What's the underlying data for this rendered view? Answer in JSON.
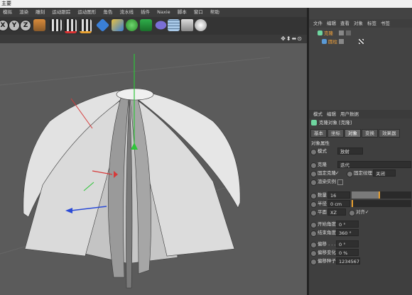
{
  "window": {
    "title": "主要"
  },
  "menu": [
    "模拟",
    "渲染",
    "雕刻",
    "运动跟踪",
    "运动图形",
    "角色",
    "流水线",
    "插件",
    "Naxie",
    "脚本",
    "窗口",
    "帮助"
  ],
  "toolbar": {
    "axis_x": "X",
    "axis_y": "Y",
    "axis_z": "Z"
  },
  "object_manager": {
    "menu": [
      "文件",
      "编辑",
      "查看",
      "对象",
      "标签",
      "书签"
    ],
    "objects": [
      {
        "name": "克隆",
        "color": "#f0a23c"
      },
      {
        "name": "圆柱",
        "color": "#f0a23c"
      }
    ]
  },
  "attribute_manager": {
    "menu": [
      "模式",
      "编辑",
      "用户数据"
    ],
    "header": "克隆对象 [克隆]",
    "tabs": [
      "基本",
      "坐标",
      "对象",
      "变换",
      "效果器"
    ],
    "active_tab": "对象",
    "section": "对象属性",
    "mode": {
      "label": "模式",
      "value": "放射"
    },
    "clone": {
      "label": "克隆",
      "value": "迭代"
    },
    "fixed_clone": {
      "label": "固定克隆",
      "check": "✓"
    },
    "fixed_texture": {
      "label": "固定纹理",
      "value": "关闭"
    },
    "render_instance": {
      "label": "渲染实例"
    },
    "count": {
      "label": "数量",
      "value": "16",
      "fill": 0.45
    },
    "radius": {
      "label": "半径",
      "value": "0 cm"
    },
    "plane": {
      "label": "平面",
      "value": "XZ"
    },
    "align": {
      "label": "对齐",
      "check": "✓"
    },
    "start_angle": {
      "label": "开始角度",
      "value": "0 °"
    },
    "end_angle": {
      "label": "结束角度",
      "value": "360 °"
    },
    "offset": {
      "label": "偏移 . . .",
      "value": "0 °"
    },
    "offset_variation": {
      "label": "偏移变化",
      "value": "0 %"
    },
    "offset_seed": {
      "label": "偏移种子",
      "value": "1234567"
    }
  },
  "colors": {
    "accent": "#e8a030",
    "viewport": "#5b5b5b",
    "panel": "#434343"
  }
}
